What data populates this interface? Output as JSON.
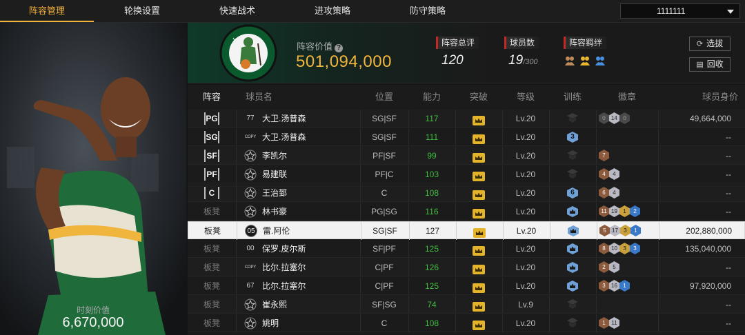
{
  "tabs": [
    {
      "label": "阵容管理",
      "active": true
    },
    {
      "label": "轮换设置",
      "active": false
    },
    {
      "label": "快速战术",
      "active": false
    },
    {
      "label": "进攻策略",
      "active": false
    },
    {
      "label": "防守策略",
      "active": false
    }
  ],
  "account": {
    "value": "1111111"
  },
  "left_panel": {
    "moment_label": "时刻价值",
    "moment_value": "6,670,000"
  },
  "team": {
    "logo_icon": "boston-celtics-logo",
    "value_label": "阵容价值",
    "value": "501,094,000",
    "rating_label": "阵容总评",
    "rating": "120",
    "count_label": "球员数",
    "count": "19",
    "count_max": "/300",
    "synergy_label": "阵容羁绊",
    "synergy_icons": [
      "synergy-bronze-icon",
      "synergy-gold-icon",
      "synergy-blue-icon"
    ],
    "select_btn": "选拔",
    "recycle_btn": "回收"
  },
  "table": {
    "headers": [
      "阵容",
      "球员名",
      "位置",
      "能力",
      "突破",
      "等级",
      "训练",
      "徽章",
      "球员身价"
    ],
    "rows": [
      {
        "slot": "PG",
        "num": "77",
        "numType": "num",
        "name": "大卫.汤普森",
        "pos": "SG|SF",
        "ovr": "117",
        "level": "Lv.20",
        "train": "",
        "badges": [
          {
            "t": "b-dark",
            "v": "0"
          },
          {
            "t": "b-silver",
            "v": "14"
          },
          {
            "t": "b-dark",
            "v": "0"
          }
        ],
        "value": "49,664,000"
      },
      {
        "slot": "SG",
        "num": "COPY",
        "numType": "copy",
        "name": "大卫.汤普森",
        "pos": "SG|SF",
        "ovr": "111",
        "level": "Lv.20",
        "train": "3",
        "badges": [],
        "value": "--"
      },
      {
        "slot": "SF",
        "num": "",
        "numType": "star",
        "name": "李凯尔",
        "pos": "PF|SF",
        "ovr": "99",
        "level": "Lv.20",
        "train": "",
        "badges": [
          {
            "t": "b-bronze",
            "v": "7"
          }
        ],
        "value": "--"
      },
      {
        "slot": "PF",
        "num": "",
        "numType": "star",
        "name": "易建联",
        "pos": "PF|C",
        "ovr": "103",
        "level": "Lv.20",
        "train": "",
        "badges": [
          {
            "t": "b-bronze",
            "v": "4"
          },
          {
            "t": "b-silver",
            "v": "4"
          }
        ],
        "value": "--"
      },
      {
        "slot": "C",
        "num": "",
        "numType": "star",
        "name": "王治郅",
        "pos": "C",
        "ovr": "108",
        "level": "Lv.20",
        "train": "6",
        "badges": [
          {
            "t": "b-bronze",
            "v": "6"
          },
          {
            "t": "b-silver",
            "v": "4"
          }
        ],
        "value": "--"
      },
      {
        "slot": "板凳",
        "num": "",
        "numType": "star",
        "name": "林书豪",
        "pos": "PG|SG",
        "ovr": "116",
        "level": "Lv.20",
        "train": "crown",
        "badges": [
          {
            "t": "b-bronze",
            "v": "11"
          },
          {
            "t": "b-silver",
            "v": "19"
          },
          {
            "t": "b-gold",
            "v": "1"
          },
          {
            "t": "b-blue",
            "v": "2"
          }
        ],
        "value": "--"
      },
      {
        "slot": "板凳",
        "num": "05",
        "numType": "medal",
        "name": "雷.阿伦",
        "pos": "SG|SF",
        "ovr": "127",
        "level": "Lv.20",
        "train": "crown",
        "badges": [
          {
            "t": "b-bronze",
            "v": "5"
          },
          {
            "t": "b-silver",
            "v": "17"
          },
          {
            "t": "b-gold",
            "v": "3"
          },
          {
            "t": "b-blue",
            "v": "1"
          }
        ],
        "value": "202,880,000",
        "selected": true
      },
      {
        "slot": "板凳",
        "num": "00",
        "numType": "num",
        "name": "保罗.皮尔斯",
        "pos": "SF|PF",
        "ovr": "125",
        "level": "Lv.20",
        "train": "crown",
        "badges": [
          {
            "t": "b-bronze",
            "v": "8"
          },
          {
            "t": "b-silver",
            "v": "10"
          },
          {
            "t": "b-gold",
            "v": "3"
          },
          {
            "t": "b-blue",
            "v": "3"
          }
        ],
        "value": "135,040,000"
      },
      {
        "slot": "板凳",
        "num": "COPY",
        "numType": "copy",
        "name": "比尔.拉塞尔",
        "pos": "C|PF",
        "ovr": "126",
        "level": "Lv.20",
        "train": "crown",
        "badges": [
          {
            "t": "b-bronze",
            "v": "2"
          },
          {
            "t": "b-silver",
            "v": "5"
          }
        ],
        "value": "--"
      },
      {
        "slot": "板凳",
        "num": "67",
        "numType": "num",
        "name": "比尔.拉塞尔",
        "pos": "C|PF",
        "ovr": "125",
        "level": "Lv.20",
        "train": "crown",
        "badges": [
          {
            "t": "b-bronze",
            "v": "3"
          },
          {
            "t": "b-silver",
            "v": "16"
          },
          {
            "t": "b-blue",
            "v": "1"
          }
        ],
        "value": "97,920,000"
      },
      {
        "slot": "板凳",
        "num": "",
        "numType": "star",
        "name": "崔永熙",
        "pos": "SF|SG",
        "ovr": "74",
        "level": "Lv.9",
        "train": "",
        "badges": [],
        "value": "--"
      },
      {
        "slot": "板凳",
        "num": "",
        "numType": "star",
        "name": "姚明",
        "pos": "C",
        "ovr": "108",
        "level": "Lv.20",
        "train": "",
        "badges": [
          {
            "t": "b-bronze",
            "v": "1"
          },
          {
            "t": "b-silver",
            "v": "11"
          }
        ],
        "value": "--"
      }
    ]
  },
  "colors": {
    "accent": "#f3b23a",
    "ovr_green": "#3fbf3f",
    "stat_red": "#c62828"
  }
}
